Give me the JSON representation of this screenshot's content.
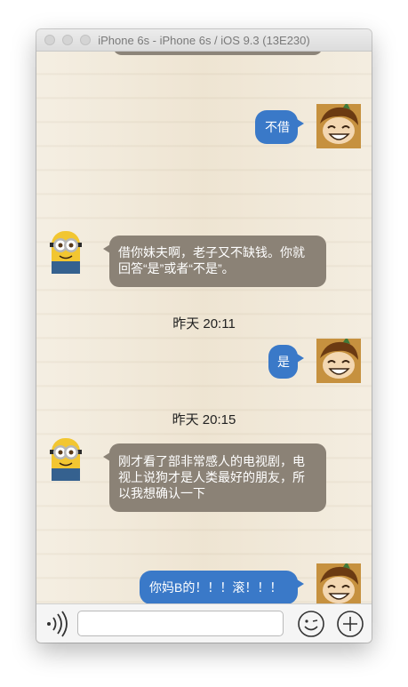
{
  "window": {
    "title": "iPhone 6s - iPhone 6s / iOS 9.3 (13E230)"
  },
  "colors": {
    "my_bubble": "#3a79c8",
    "other_bubble": "#8b8276",
    "background": "#f1e9d9"
  },
  "messages": [
    {
      "side": "right",
      "text": "不借"
    },
    {
      "side": "left",
      "lines": [
        "借你妹夫啊，老子又不缺钱。你就",
        "回答“是”或者“不是”。"
      ]
    },
    {
      "timestamp": "昨天 20:11"
    },
    {
      "side": "right",
      "text": "是"
    },
    {
      "timestamp": "昨天 20:15"
    },
    {
      "side": "left",
      "lines": [
        "刚才看了部非常感人的电视剧，电",
        "视上说狗才是人类最好的朋友，所",
        "以我想确认一下"
      ]
    },
    {
      "side": "right",
      "text": "你妈B的！！！滚！！！"
    }
  ],
  "input_bar": {
    "voice_icon": "voice-wave-icon",
    "message_input_value": "",
    "emoji_icon": "smiley-face-icon",
    "add_icon": "plus-circle-icon"
  }
}
